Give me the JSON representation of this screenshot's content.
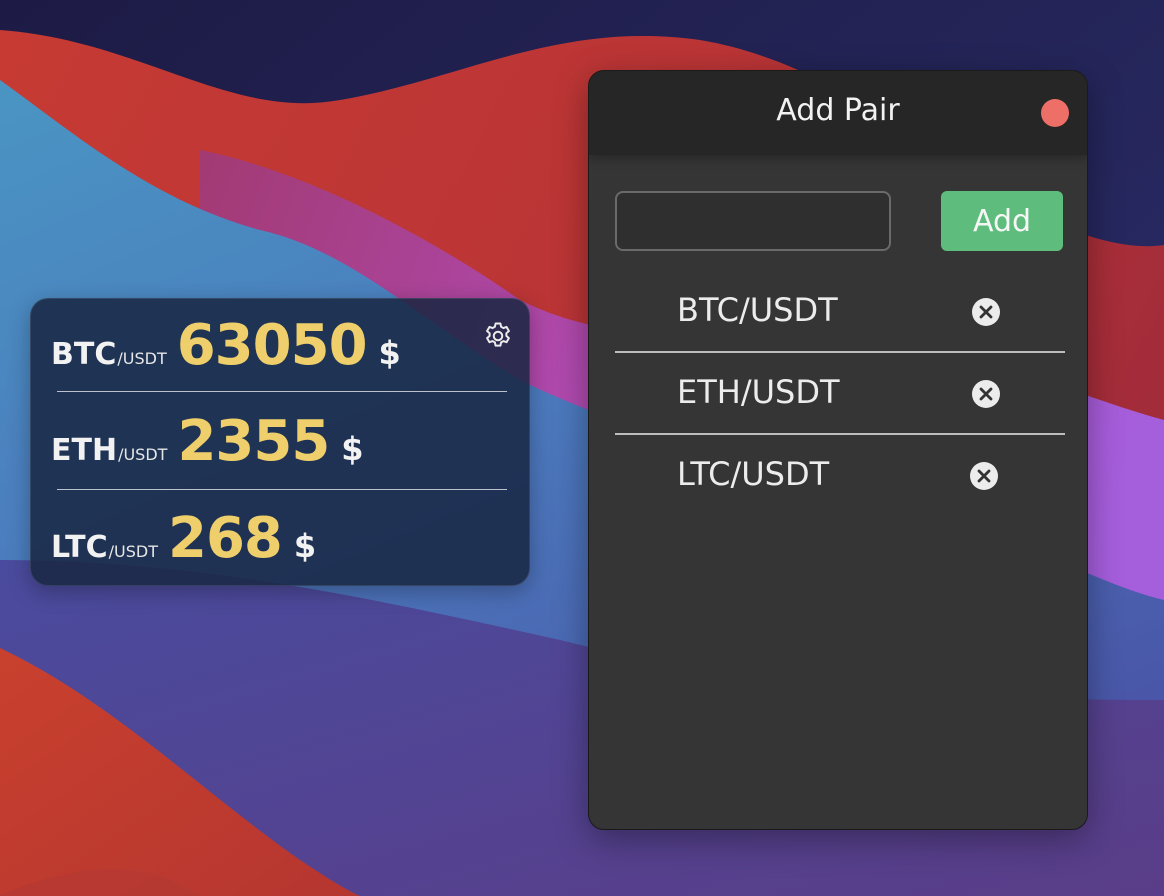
{
  "ticker": {
    "rows": [
      {
        "symbol": "BTC",
        "quote": "/USDT",
        "price": "63050",
        "currency": "$"
      },
      {
        "symbol": "ETH",
        "quote": "/USDT",
        "price": "2355",
        "currency": "$"
      },
      {
        "symbol": "LTC",
        "quote": "/USDT",
        "price": "268",
        "currency": "$"
      }
    ],
    "settings_icon": "gear-icon"
  },
  "add_pair_window": {
    "title": "Add Pair",
    "close_icon": "close-icon",
    "input": {
      "value": "",
      "placeholder": ""
    },
    "add_label": "Add",
    "pairs": [
      {
        "label": "BTC/USDT",
        "remove_icon": "remove-circle-x-icon"
      },
      {
        "label": "ETH/USDT",
        "remove_icon": "remove-circle-x-icon"
      },
      {
        "label": "LTC/USDT",
        "remove_icon": "remove-circle-x-icon"
      }
    ]
  },
  "colors": {
    "price": "#efcf6b",
    "add_button": "#5ebd7d",
    "close_button": "#ee6f67",
    "window_background": "#353535",
    "titlebar": "#262626",
    "widget_background": "#182642"
  }
}
